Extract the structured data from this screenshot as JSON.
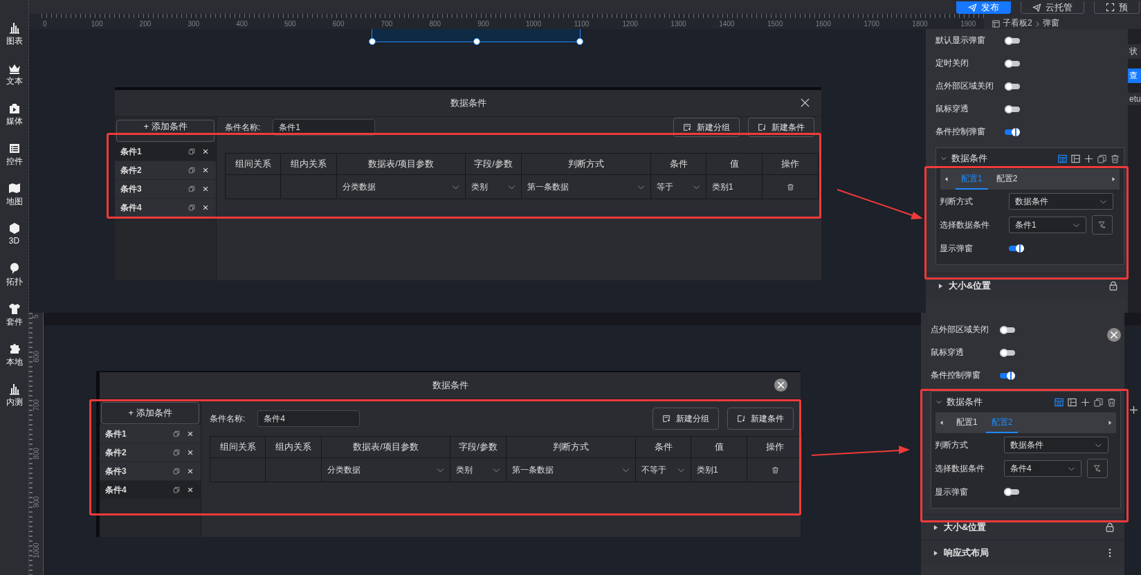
{
  "sidebar": {
    "items": [
      {
        "kind": "chart",
        "label": "图表"
      },
      {
        "kind": "text",
        "label": "文本"
      },
      {
        "kind": "media",
        "label": "媒体"
      },
      {
        "kind": "control",
        "label": "控件"
      },
      {
        "kind": "map",
        "label": "地图"
      },
      {
        "kind": "cube",
        "label": "3D"
      },
      {
        "kind": "topology",
        "label": "拓扑"
      },
      {
        "kind": "kit",
        "label": "套件"
      },
      {
        "kind": "local",
        "label": "本地"
      },
      {
        "kind": "beta",
        "label": "内测"
      }
    ]
  },
  "toolbar": {
    "buttons": [
      {
        "kind": "send",
        "label": "发布",
        "primary": true
      },
      {
        "kind": "send",
        "label": "云托管",
        "primary": false
      },
      {
        "kind": "fullscreen",
        "label": "预",
        "primary": false
      }
    ]
  },
  "ruler": {
    "labels": [
      "0",
      "100",
      "200",
      "300",
      "400",
      "500",
      "600",
      "700",
      "800",
      "900",
      "1000",
      "1100",
      "1200",
      "1300",
      "1400",
      "1500",
      "1600",
      "1700",
      "1800",
      "1900"
    ]
  },
  "breadcrumb": [
    "子看板2",
    "弹窗"
  ],
  "edge_strip": [
    {
      "label": "状",
      "selected": false
    },
    {
      "label": "查",
      "selected": true
    },
    {
      "label": "etu",
      "selected": false
    }
  ],
  "screens": [
    {
      "dialog": {
        "title": "数据条件",
        "close": {
          "kind": "x"
        },
        "add_label": "+ 添加条件",
        "conditions": [
          {
            "label": "条件1",
            "selected": true
          },
          {
            "label": "条件2",
            "selected": false
          },
          {
            "label": "条件3",
            "selected": false
          },
          {
            "label": "条件4",
            "selected": false
          }
        ],
        "name_label": "条件名称:",
        "name_value": "条件1",
        "buttons": [
          {
            "kind": "group",
            "label": "新建分组"
          },
          {
            "kind": "add",
            "label": "新建条件"
          }
        ],
        "columns": [
          "组间关系",
          "组内关系",
          "数据表/项目参数",
          "字段/参数",
          "判断方式",
          "条件",
          "值",
          "操作"
        ],
        "rows": [
          {
            "cells": [
              {
                "kind": "blank"
              },
              {
                "kind": "blank"
              },
              {
                "kind": "select",
                "value": "分类数据"
              },
              {
                "kind": "select",
                "value": "类别"
              },
              {
                "kind": "select",
                "value": "第一条数据"
              },
              {
                "kind": "select",
                "value": "等于"
              },
              {
                "kind": "text",
                "value": "类别1"
              },
              {
                "kind": "delete"
              }
            ]
          }
        ]
      },
      "panel": {
        "toggles": [
          {
            "label": "默认显示弹窗",
            "on": false
          },
          {
            "label": "定时关闭",
            "on": false
          },
          {
            "label": "点外部区域关闭",
            "on": false
          },
          {
            "label": "鼠标穿透",
            "on": false
          },
          {
            "label": "条件控制弹窗",
            "on": true
          }
        ],
        "box_title": "数据条件",
        "tabs": [
          {
            "label": "配置1",
            "selected": true
          },
          {
            "label": "配置2",
            "selected": false
          }
        ],
        "fields": [
          {
            "kind": "select",
            "label": "判断方式",
            "value": "数据条件"
          },
          {
            "kind": "select",
            "label": "选择数据条件",
            "value": "条件1",
            "filter_button": true
          },
          {
            "kind": "toggle",
            "label": "显示弹窗",
            "on": true
          }
        ],
        "sections": [
          {
            "kind": "lock",
            "label": "大小&位置"
          }
        ]
      }
    },
    {
      "dialog": {
        "title": "数据条件",
        "close": {
          "kind": "circle"
        },
        "add_label": "+ 添加条件",
        "conditions": [
          {
            "label": "条件1",
            "selected": false
          },
          {
            "label": "条件2",
            "selected": false
          },
          {
            "label": "条件3",
            "selected": false
          },
          {
            "label": "条件4",
            "selected": true
          }
        ],
        "name_label": "条件名称:",
        "name_value": "条件4",
        "buttons": [
          {
            "kind": "group",
            "label": "新建分组"
          },
          {
            "kind": "add",
            "label": "新建条件"
          }
        ],
        "columns": [
          "组间关系",
          "组内关系",
          "数据表/项目参数",
          "字段/参数",
          "判断方式",
          "条件",
          "值",
          "操作"
        ],
        "rows": [
          {
            "cells": [
              {
                "kind": "blank"
              },
              {
                "kind": "blank"
              },
              {
                "kind": "select",
                "value": "分类数据"
              },
              {
                "kind": "select",
                "value": "类别"
              },
              {
                "kind": "select",
                "value": "第一条数据"
              },
              {
                "kind": "select",
                "value": "不等于"
              },
              {
                "kind": "text",
                "value": "类别1"
              },
              {
                "kind": "delete"
              }
            ]
          }
        ]
      },
      "panel": {
        "close_button": true,
        "toggles": [
          {
            "label": "点外部区域关闭",
            "on": false
          },
          {
            "label": "鼠标穿透",
            "on": false
          },
          {
            "label": "条件控制弹窗",
            "on": true
          }
        ],
        "box_title": "数据条件",
        "tabs": [
          {
            "label": "配置1",
            "selected": false
          },
          {
            "label": "配置2",
            "selected": true
          }
        ],
        "fields": [
          {
            "kind": "select",
            "label": "判断方式",
            "value": "数据条件"
          },
          {
            "kind": "select",
            "label": "选择数据条件",
            "value": "条件4",
            "filter_button": true
          },
          {
            "kind": "toggle",
            "label": "显示弹窗",
            "on": false
          }
        ],
        "sections": [
          {
            "kind": "lock",
            "label": "大小&位置"
          },
          {
            "kind": "more",
            "label": "响应式布局"
          }
        ]
      }
    }
  ],
  "vertical_ruler": {
    "labels": [
      "5",
      "600",
      "700",
      "800",
      "900",
      "1000"
    ]
  }
}
